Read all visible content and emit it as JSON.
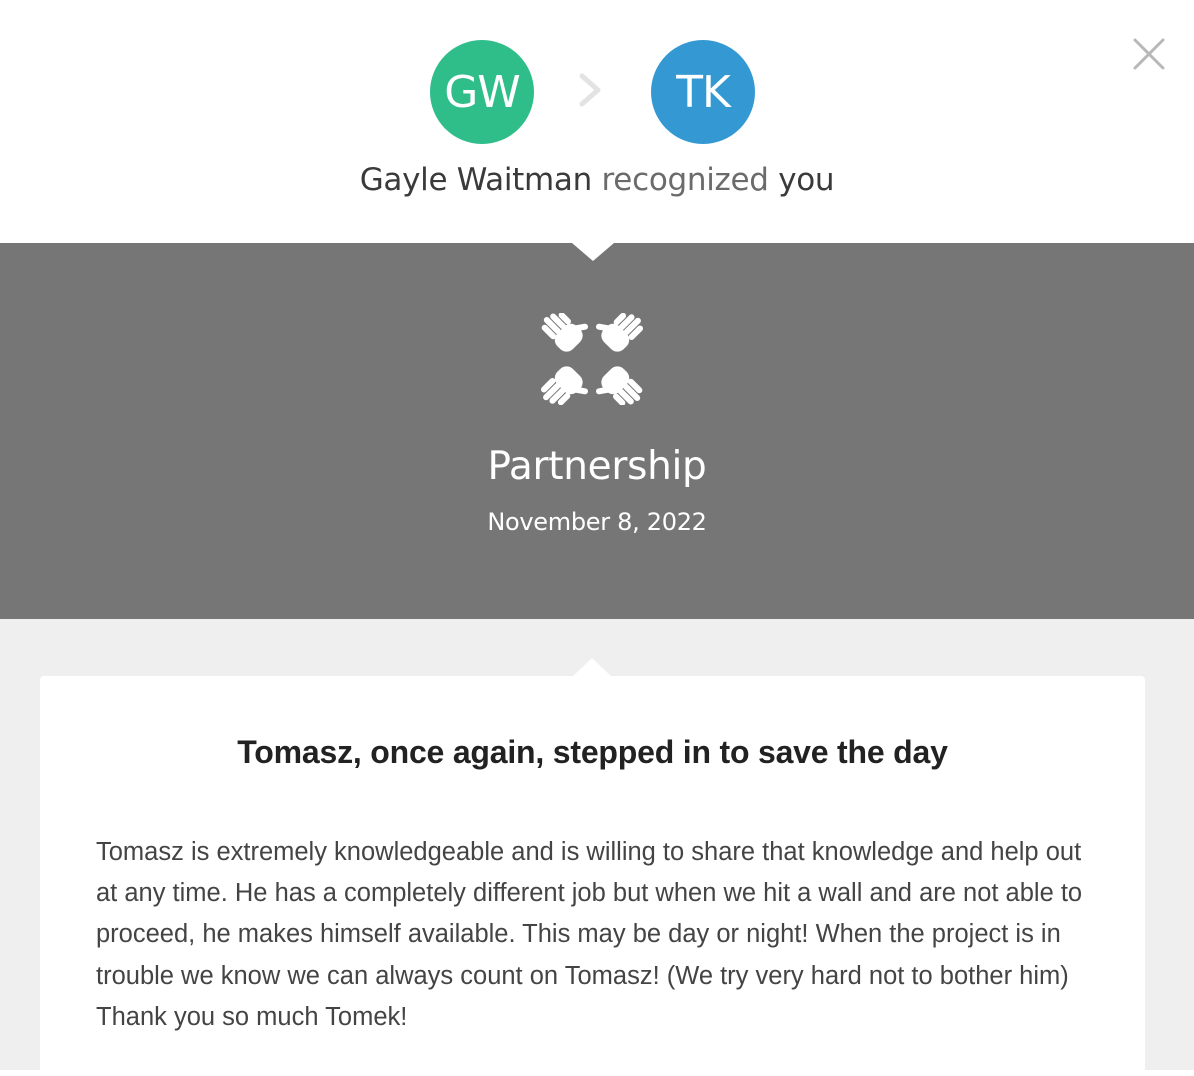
{
  "header": {
    "giver_initials": "GW",
    "receiver_initials": "TK",
    "giver_name": "Gayle Waitman",
    "action_text": "recognized",
    "recipient_text": "you",
    "giver_color": "#2fbd8a",
    "receiver_color": "#3499d2"
  },
  "award": {
    "icon": "partnership-hands-icon",
    "title": "Partnership",
    "date": "November 8, 2022",
    "band_color": "#767676"
  },
  "message": {
    "title": "Tomasz, once again, stepped in to save the day",
    "body": "Tomasz is extremely knowledgeable and is willing to share that knowledge and help out at any time. He has a completely different job but when we hit a wall and are not able to proceed, he makes himself available. This may be day or night! When the project is in trouble we know we can always count on Tomasz! (We try very hard not to bother him) Thank you so much Tomek!"
  }
}
